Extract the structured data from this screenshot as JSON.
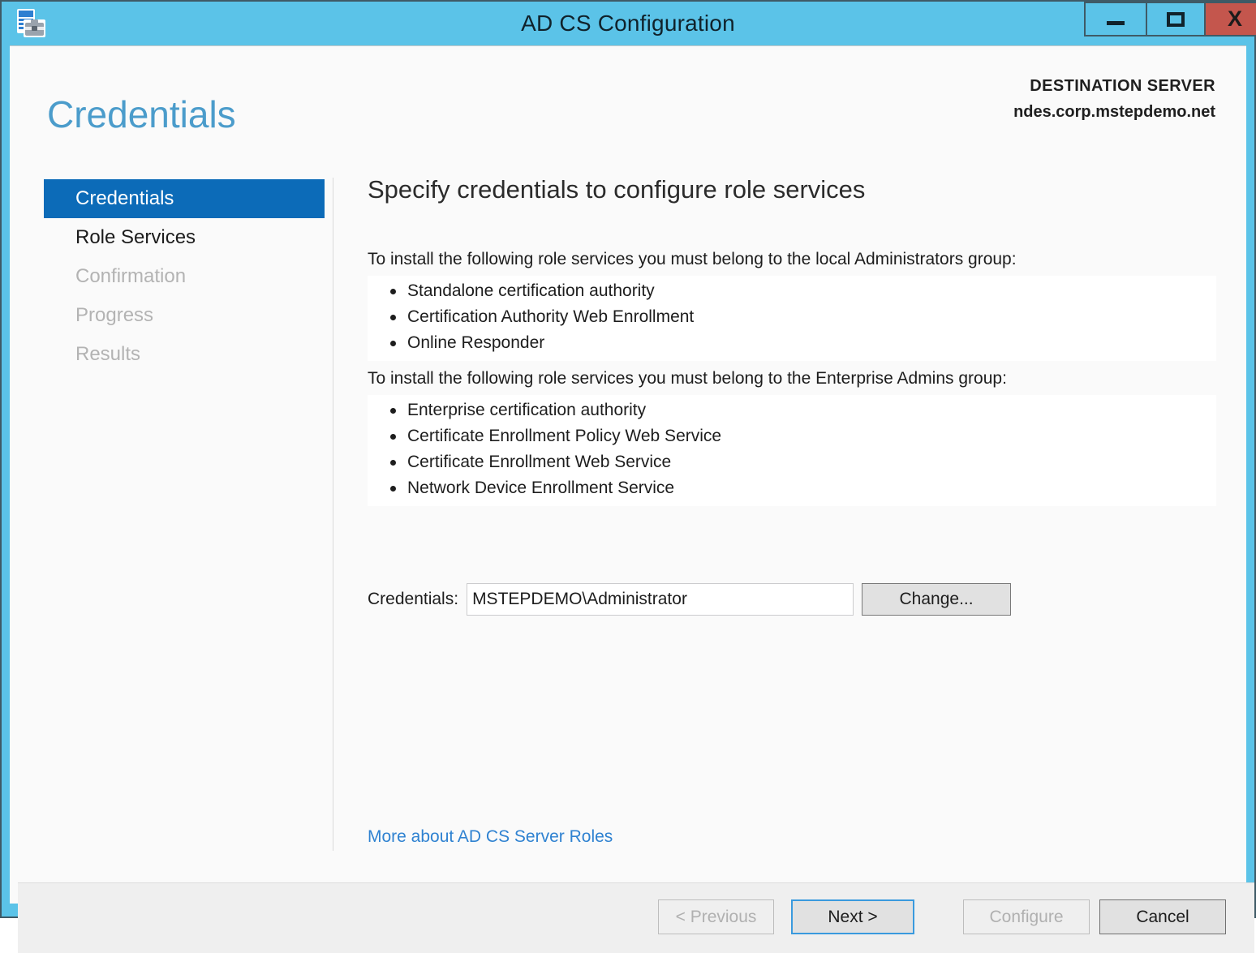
{
  "window": {
    "title": "AD CS Configuration",
    "icon": "config-toolbox-icon",
    "controls": {
      "minimize": "minimize-icon",
      "maximize": "maximize-icon",
      "close": "X"
    },
    "frame_color": "#5bc3e8"
  },
  "header": {
    "page_title": "Credentials",
    "destination_label": "DESTINATION SERVER",
    "destination_server": "ndes.corp.mstepdemo.net"
  },
  "sidebar": {
    "items": [
      {
        "label": "Credentials",
        "state": "selected"
      },
      {
        "label": "Role Services",
        "state": "available"
      },
      {
        "label": "Confirmation",
        "state": "disabled"
      },
      {
        "label": "Progress",
        "state": "disabled"
      },
      {
        "label": "Results",
        "state": "disabled"
      }
    ],
    "selected_color": "#0c6bb8"
  },
  "main": {
    "heading": "Specify credentials to configure role services",
    "groups": [
      {
        "intro": "To install the following role services you must belong to the local Administrators group:",
        "services": [
          "Standalone certification authority",
          "Certification Authority Web Enrollment",
          "Online Responder"
        ]
      },
      {
        "intro": "To install the following role services you must belong to the Enterprise Admins group:",
        "services": [
          "Enterprise certification authority",
          "Certificate Enrollment Policy Web Service",
          "Certificate Enrollment Web Service",
          "Network Device Enrollment Service"
        ]
      }
    ],
    "credentials": {
      "label": "Credentials:",
      "value": "MSTEPDEMO\\Administrator",
      "placeholder": "",
      "change_button": "Change..."
    },
    "more_link": "More about AD CS Server Roles"
  },
  "footer": {
    "previous": "< Previous",
    "next": "Next >",
    "configure": "Configure",
    "cancel": "Cancel"
  }
}
